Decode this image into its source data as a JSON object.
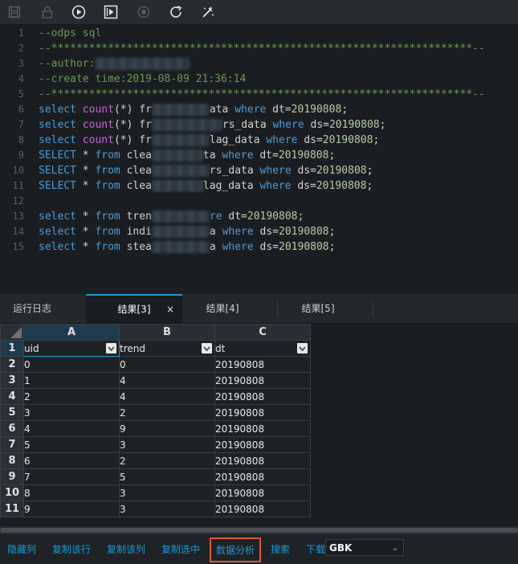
{
  "toolbar": {
    "buttons": [
      "save-icon",
      "lock-icon",
      "run-icon",
      "run-selected-icon",
      "stop-icon",
      "refresh-icon",
      "format-icon"
    ]
  },
  "editor": {
    "line_numbers": [
      "1",
      "2",
      "3",
      "4",
      "5",
      "6",
      "7",
      "8",
      "9",
      "10",
      "11",
      "12",
      "13",
      "14",
      "15"
    ],
    "line1": "--odps sql",
    "line2": "--*******************************************************************--",
    "line3": "--author:",
    "line4": "--create time:2019-08-09 21:36:14",
    "line5": "--*******************************************************************--",
    "l6": {
      "a": "select",
      "b": " count",
      "c": "(*) fr",
      "d": "ata ",
      "e": "where",
      "f": " dt=",
      "g": "20190808",
      "h": ";"
    },
    "l7": {
      "a": "select",
      "b": " count",
      "c": "(*) fr",
      "d": "rs_data ",
      "e": "where",
      "f": " ds=",
      "g": "20190808",
      "h": ";"
    },
    "l8": {
      "a": "select",
      "b": " count",
      "c": "(*) fr",
      "d": "lag_data ",
      "e": "where",
      "f": " ds=",
      "g": "20190808",
      "h": ";"
    },
    "l9": {
      "a": "SELECT",
      "c": " * ",
      "k": "from",
      "d1": " clea",
      "d": "ta ",
      "e": "where",
      "f": " dt=",
      "g": "20190808",
      "h": ";"
    },
    "l10": {
      "a": "SELECT",
      "c": " * ",
      "k": "from",
      "d1": " clea",
      "d": "rs_data ",
      "e": "where",
      "f": " ds=",
      "g": "20190808",
      "h": ";"
    },
    "l11": {
      "a": "SELECT",
      "c": " * ",
      "k": "from",
      "d1": " clea",
      "d": "lag_data ",
      "e": "where",
      "f": " ds=",
      "g": "20190808",
      "h": ";"
    },
    "l13": {
      "a": "select",
      "c": " * ",
      "k": "from",
      "d1": " tren",
      "d": "re",
      "f": " dt=",
      "g": "20190808",
      "h": ";"
    },
    "l14": {
      "a": "select",
      "c": " * ",
      "k": "from",
      "d1": " indi",
      "d": "a ",
      "e": "where",
      "f": " ds=",
      "g": "20190808",
      "h": ";"
    },
    "l15": {
      "a": "select",
      "c": " * ",
      "k": "from",
      "d1": " stea",
      "d": "a ",
      "e": "where",
      "f": " ds=",
      "g": "20190808",
      "h": ";"
    }
  },
  "tabs": {
    "log": "运行日志",
    "result3": "结果[3]",
    "close": "×",
    "result4": "结果[4]",
    "result5": "结果[5]"
  },
  "grid": {
    "columns": [
      "A",
      "B",
      "C"
    ],
    "header_row_number": "1",
    "header": [
      "uid",
      "trend",
      "dt"
    ],
    "rows": [
      {
        "n": "2",
        "cells": [
          "0",
          "0",
          "20190808"
        ]
      },
      {
        "n": "3",
        "cells": [
          "1",
          "4",
          "20190808"
        ]
      },
      {
        "n": "4",
        "cells": [
          "2",
          "4",
          "20190808"
        ]
      },
      {
        "n": "5",
        "cells": [
          "3",
          "2",
          "20190808"
        ]
      },
      {
        "n": "6",
        "cells": [
          "4",
          "9",
          "20190808"
        ]
      },
      {
        "n": "7",
        "cells": [
          "5",
          "3",
          "20190808"
        ]
      },
      {
        "n": "8",
        "cells": [
          "6",
          "2",
          "20190808"
        ]
      },
      {
        "n": "9",
        "cells": [
          "7",
          "5",
          "20190808"
        ]
      },
      {
        "n": "10",
        "cells": [
          "8",
          "3",
          "20190808"
        ]
      },
      {
        "n": "11",
        "cells": [
          "9",
          "3",
          "20190808"
        ]
      }
    ]
  },
  "bottombar": {
    "hide_col": "隐藏列",
    "copy_row": "复制该行",
    "copy_col": "复制该列",
    "copy_sel": "复制选中",
    "analysis": "数据分析",
    "search": "搜索",
    "download": "下载",
    "encoding": "GBK"
  },
  "colors": {
    "accent": "#1d9ad6",
    "highlight_box": "#e05a3a"
  }
}
